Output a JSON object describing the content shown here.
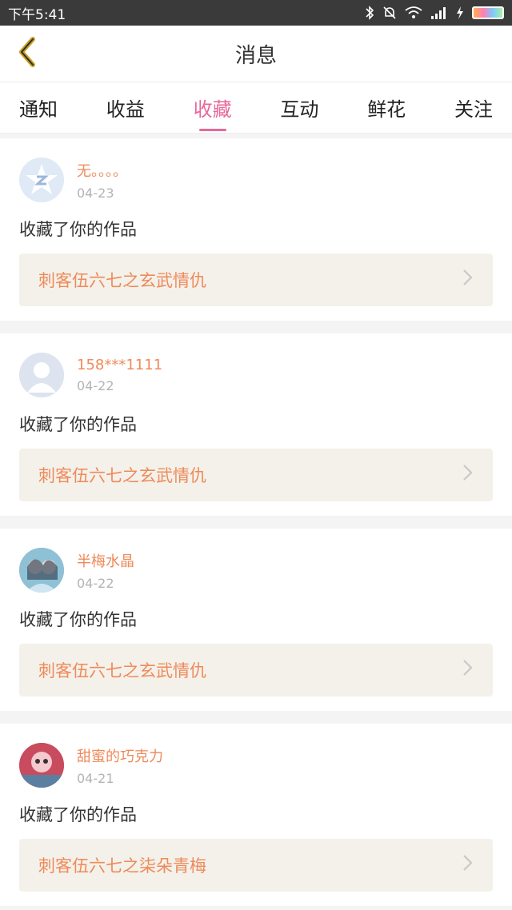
{
  "status": {
    "time": "下午5:41"
  },
  "header": {
    "title": "消息"
  },
  "tabs": [
    {
      "label": "通知"
    },
    {
      "label": "收益"
    },
    {
      "label": "收藏"
    },
    {
      "label": "互动"
    },
    {
      "label": "鲜花"
    },
    {
      "label": "关注"
    }
  ],
  "items": [
    {
      "username": "无。。。。",
      "date": "04-23",
      "action": "收藏了你的作品",
      "work": "刺客伍六七之玄武情仇"
    },
    {
      "username": "158***1111",
      "date": "04-22",
      "action": "收藏了你的作品",
      "work": "刺客伍六七之玄武情仇"
    },
    {
      "username": "半梅水晶",
      "date": "04-22",
      "action": "收藏了你的作品",
      "work": "刺客伍六七之玄武情仇"
    },
    {
      "username": "甜蜜的巧克力",
      "date": "04-21",
      "action": "收藏了你的作品",
      "work": "刺客伍六七之柒朵青梅"
    }
  ],
  "colors": {
    "accent": "#e8679a",
    "orange": "#ef8a5a",
    "back": "#c9a227"
  }
}
